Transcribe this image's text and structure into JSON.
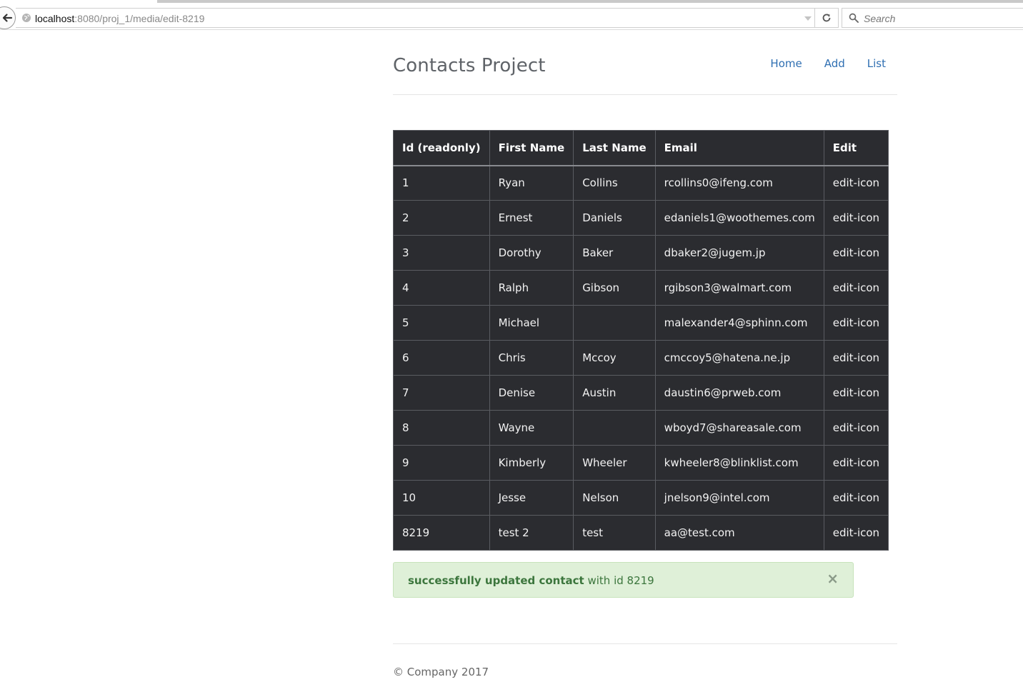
{
  "browser": {
    "url_host": "localhost",
    "url_rest": ":8080/proj_1/media/edit-8219",
    "search_placeholder": "Search"
  },
  "header": {
    "brand": "Contacts Project",
    "nav": [
      {
        "label": "Home"
      },
      {
        "label": "Add"
      },
      {
        "label": "List"
      }
    ]
  },
  "table": {
    "columns": [
      "Id (readonly)",
      "First Name",
      "Last Name",
      "Email",
      "Edit"
    ],
    "rows": [
      {
        "id": "1",
        "first": "Ryan",
        "last": "Collins",
        "email": "rcollins0@ifeng.com",
        "edit": "edit-icon"
      },
      {
        "id": "2",
        "first": "Ernest",
        "last": "Daniels",
        "email": "edaniels1@woothemes.com",
        "edit": "edit-icon"
      },
      {
        "id": "3",
        "first": "Dorothy",
        "last": "Baker",
        "email": "dbaker2@jugem.jp",
        "edit": "edit-icon"
      },
      {
        "id": "4",
        "first": "Ralph",
        "last": "Gibson",
        "email": "rgibson3@walmart.com",
        "edit": "edit-icon"
      },
      {
        "id": "5",
        "first": "Michael",
        "last": "",
        "email": "malexander4@sphinn.com",
        "edit": "edit-icon"
      },
      {
        "id": "6",
        "first": "Chris",
        "last": "Mccoy",
        "email": "cmccoy5@hatena.ne.jp",
        "edit": "edit-icon"
      },
      {
        "id": "7",
        "first": "Denise",
        "last": "Austin",
        "email": "daustin6@prweb.com",
        "edit": "edit-icon"
      },
      {
        "id": "8",
        "first": "Wayne",
        "last": "",
        "email": "wboyd7@shareasale.com",
        "edit": "edit-icon"
      },
      {
        "id": "9",
        "first": "Kimberly",
        "last": "Wheeler",
        "email": "kwheeler8@blinklist.com",
        "edit": "edit-icon"
      },
      {
        "id": "10",
        "first": "Jesse",
        "last": "Nelson",
        "email": "jnelson9@intel.com",
        "edit": "edit-icon"
      },
      {
        "id": "8219",
        "first": "test 2",
        "last": "test",
        "email": "aa@test.com",
        "edit": "edit-icon"
      }
    ]
  },
  "alert": {
    "strong": "successfully updated contact",
    "rest": " with id 8219",
    "close": "×"
  },
  "footer": {
    "text": "© Company 2017"
  },
  "icons": {
    "back": "back-arrow-icon",
    "site": "globe-icon",
    "dropdown": "dropdown-arrow-icon",
    "reload": "reload-icon",
    "search": "search-icon"
  },
  "colors": {
    "table_bg": "#2b2c30",
    "link": "#2f6fb2",
    "alert_bg": "#dff0d8",
    "alert_text": "#3c763d"
  }
}
